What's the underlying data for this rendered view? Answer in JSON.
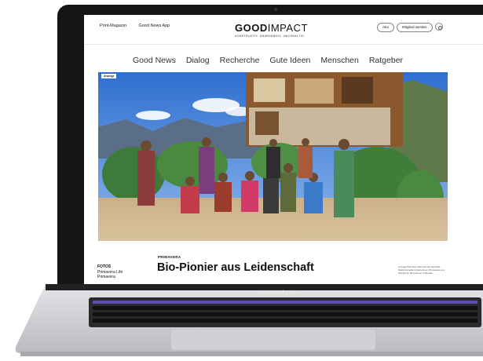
{
  "device": {
    "label": "MacBook Pro"
  },
  "site": {
    "top_links": [
      "Print-Magazin",
      "Good News App"
    ],
    "logo_bold": "GOOD",
    "logo_thin": "IMPACT",
    "tagline": "KONSTRUKTIV. UNABHÄNGIG. NACHHALTIG.",
    "abo_label": "Abo",
    "member_label": "Mitglied werden"
  },
  "nav": {
    "items": [
      "Good News",
      "Dialog",
      "Recherche",
      "Gute Ideen",
      "Menschen",
      "Ratgeber"
    ]
  },
  "hero": {
    "badge": "Anzeige"
  },
  "article": {
    "kicker": "PRIMAVERA",
    "headline": "Bio-Pionier aus Leidenschaft",
    "photo_credit_heading": "FOTOS",
    "photo_credits": [
      "Primavera Life",
      "Primavera"
    ],
    "side_note": "Anzeige/Seit über Jahrzehnten baut das Naturkosmetik-Unternehmen Primavera eine Zukunft für Bio-Kräuter in Bhutan"
  },
  "colors": {
    "accent": "#111111",
    "screen_bg": "#ffffff",
    "laptop_body": "#c9cbd0"
  }
}
